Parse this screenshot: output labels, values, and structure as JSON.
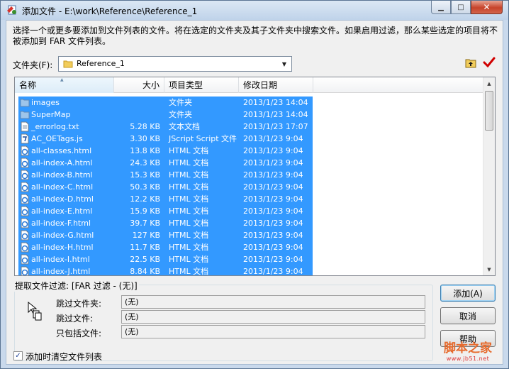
{
  "window": {
    "title": "添加文件 - E:\\work\\Reference\\Reference_1",
    "min_glyph": "▁",
    "max_glyph": "□",
    "close_glyph": "✕"
  },
  "description": "选择一个或更多要添加到文件列表的文件。将在选定的文件夹及其子文件夹中搜索文件。如果启用过滤，那么某些选定的项目将不被添加到 FAR 文件列表。",
  "folder": {
    "label": "文件夹(F):",
    "value": "Reference_1",
    "dropdown_glyph": "▼"
  },
  "list": {
    "columns": [
      "名称",
      "大小",
      "项目类型",
      "修改日期"
    ],
    "sort_glyph": "▲",
    "rows": [
      {
        "icon": "folder-icon",
        "name": "images",
        "size": "",
        "type": "文件夹",
        "date": "2013/1/23 14:04"
      },
      {
        "icon": "folder-icon",
        "name": "SuperMap",
        "size": "",
        "type": "文件夹",
        "date": "2013/1/23 14:04"
      },
      {
        "icon": "text-file-icon",
        "name": "_errorlog.txt",
        "size": "5.28 KB",
        "type": "文本文档",
        "date": "2013/1/23 17:07"
      },
      {
        "icon": "script-file-icon",
        "name": "AC_OETags.js",
        "size": "3.30 KB",
        "type": "JScript Script 文件",
        "date": "2013/1/23 9:04"
      },
      {
        "icon": "html-file-icon",
        "name": "all-classes.html",
        "size": "13.8 KB",
        "type": "HTML 文档",
        "date": "2013/1/23 9:04"
      },
      {
        "icon": "html-file-icon",
        "name": "all-index-A.html",
        "size": "24.3 KB",
        "type": "HTML 文档",
        "date": "2013/1/23 9:04"
      },
      {
        "icon": "html-file-icon",
        "name": "all-index-B.html",
        "size": "15.3 KB",
        "type": "HTML 文档",
        "date": "2013/1/23 9:04"
      },
      {
        "icon": "html-file-icon",
        "name": "all-index-C.html",
        "size": "50.3 KB",
        "type": "HTML 文档",
        "date": "2013/1/23 9:04"
      },
      {
        "icon": "html-file-icon",
        "name": "all-index-D.html",
        "size": "12.2 KB",
        "type": "HTML 文档",
        "date": "2013/1/23 9:04"
      },
      {
        "icon": "html-file-icon",
        "name": "all-index-E.html",
        "size": "15.9 KB",
        "type": "HTML 文档",
        "date": "2013/1/23 9:04"
      },
      {
        "icon": "html-file-icon",
        "name": "all-index-F.html",
        "size": "39.7 KB",
        "type": "HTML 文档",
        "date": "2013/1/23 9:04"
      },
      {
        "icon": "html-file-icon",
        "name": "all-index-G.html",
        "size": "127 KB",
        "type": "HTML 文档",
        "date": "2013/1/23 9:04"
      },
      {
        "icon": "html-file-icon",
        "name": "all-index-H.html",
        "size": "11.7 KB",
        "type": "HTML 文档",
        "date": "2013/1/23 9:04"
      },
      {
        "icon": "html-file-icon",
        "name": "all-index-I.html",
        "size": "22.5 KB",
        "type": "HTML 文档",
        "date": "2013/1/23 9:04"
      },
      {
        "icon": "html-file-icon",
        "name": "all-index-J.html",
        "size": "8.84 KB",
        "type": "HTML 文档",
        "date": "2013/1/23 9:04"
      }
    ],
    "scroll_up_glyph": "▲",
    "scroll_down_glyph": "▼"
  },
  "filter": {
    "title": "提取文件过滤: [FAR 过滤 - (无)]",
    "skip_folders_label": "跳过文件夹:",
    "skip_folders_value": "(无)",
    "skip_files_label": "跳过文件:",
    "skip_files_value": "(无)",
    "include_only_label": "只包括文件:",
    "include_only_value": "(无)"
  },
  "buttons": {
    "add": "添加(A)",
    "cancel": "取消",
    "help": "帮助"
  },
  "clear_checkbox": {
    "label": "添加时清空文件列表",
    "checked": true,
    "glyph": "✓"
  },
  "watermark": {
    "main": "脚本之家",
    "sub": "www.jb51.net"
  },
  "colors": {
    "selection": "#3399ff",
    "selection_text": "#ffffff",
    "check_mark": "#d00000"
  }
}
